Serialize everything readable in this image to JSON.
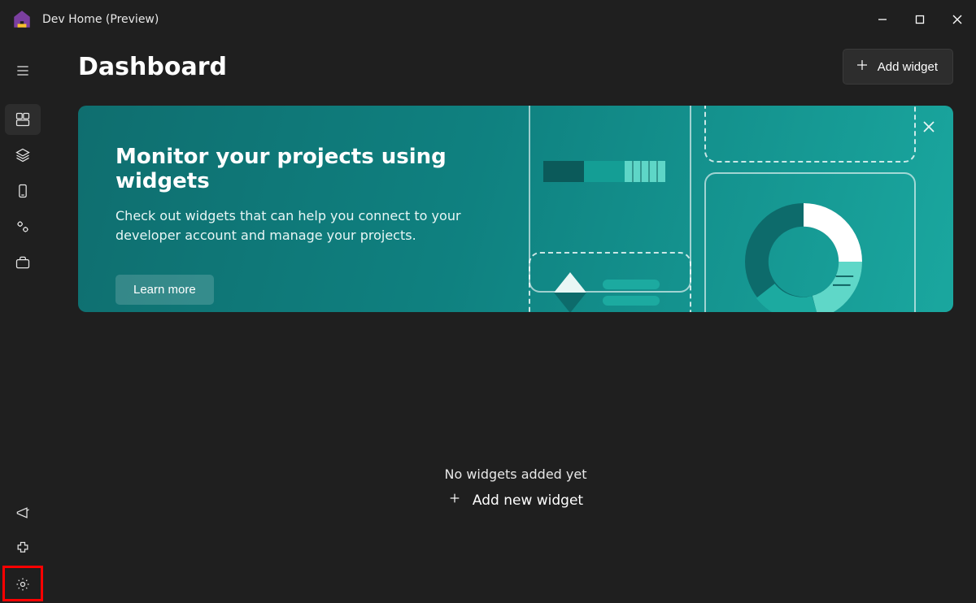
{
  "window": {
    "title": "Dev Home (Preview)"
  },
  "page": {
    "title": "Dashboard",
    "add_widget_label": "Add widget"
  },
  "banner": {
    "title": "Monitor your projects using widgets",
    "subtitle": "Check out widgets that can help you connect to your developer account and manage your projects.",
    "learn_more_label": "Learn more"
  },
  "empty": {
    "message": "No widgets added yet",
    "add_label": "Add new widget"
  },
  "sidebar": {
    "top": [
      {
        "name": "menu"
      },
      {
        "name": "dashboard",
        "active": true
      },
      {
        "name": "stacks"
      },
      {
        "name": "device"
      },
      {
        "name": "services"
      },
      {
        "name": "toolbox"
      }
    ],
    "bottom": [
      {
        "name": "feedback"
      },
      {
        "name": "extensions"
      },
      {
        "name": "settings"
      }
    ]
  }
}
